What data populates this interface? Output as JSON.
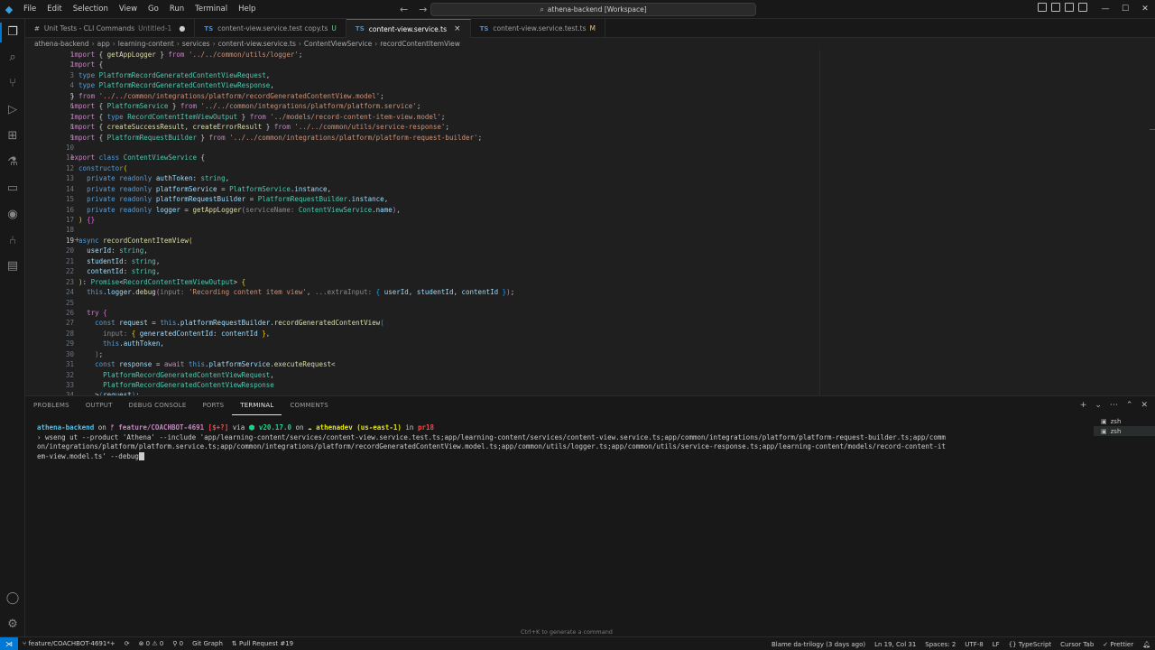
{
  "menu": [
    "File",
    "Edit",
    "Selection",
    "View",
    "Go",
    "Run",
    "Terminal",
    "Help"
  ],
  "search": {
    "label": "athena-backend [Workspace]"
  },
  "tabs": [
    {
      "icon": "#",
      "label": "Unit Tests - CLI Commands",
      "sub": "Untitled-1",
      "state": "dot"
    },
    {
      "icon": "TS",
      "label": "content-view.service.test copy.ts",
      "sub": "U",
      "state": ""
    },
    {
      "icon": "TS",
      "label": "content-view.service.ts",
      "sub": "",
      "state": "close"
    },
    {
      "icon": "TS",
      "label": "content-view.service.test.ts",
      "sub": "M",
      "state": ""
    }
  ],
  "breadcrumb": [
    "athena-backend",
    "app",
    "learning-content",
    "services",
    "content-view.service.ts",
    "ContentViewService",
    "recordContentItemView"
  ],
  "editor": {
    "current_line": 19,
    "lines": [
      [
        [
          "kw2",
          "import"
        ],
        [
          "plain",
          " { "
        ],
        [
          "fn",
          "getAppLogger"
        ],
        [
          "plain",
          " } "
        ],
        [
          "kw2",
          "from"
        ],
        [
          "str",
          " '../../common/utils/logger'"
        ],
        [
          "plain",
          ";"
        ]
      ],
      [
        [
          "kw2",
          "import"
        ],
        [
          "plain",
          " {"
        ]
      ],
      [
        [
          "plain",
          "  "
        ],
        [
          "kw",
          "type"
        ],
        [
          "ty",
          " PlatformRecordGeneratedContentViewRequest"
        ],
        [
          "plain",
          ","
        ]
      ],
      [
        [
          "plain",
          "  "
        ],
        [
          "kw",
          "type"
        ],
        [
          "ty",
          " PlatformRecordGeneratedContentViewResponse"
        ],
        [
          "plain",
          ","
        ]
      ],
      [
        [
          "plain",
          "} "
        ],
        [
          "kw2",
          "from"
        ],
        [
          "str",
          " '../../common/integrations/platform/recordGeneratedContentView.model'"
        ],
        [
          "plain",
          ";"
        ]
      ],
      [
        [
          "kw2",
          "import"
        ],
        [
          "plain",
          " { "
        ],
        [
          "ty",
          "PlatformService"
        ],
        [
          "plain",
          " } "
        ],
        [
          "kw2",
          "from"
        ],
        [
          "str",
          " '../../common/integrations/platform/platform.service'"
        ],
        [
          "plain",
          ";"
        ]
      ],
      [
        [
          "kw2",
          "import"
        ],
        [
          "plain",
          " { "
        ],
        [
          "kw",
          "type"
        ],
        [
          "ty",
          " RecordContentItemViewOutput"
        ],
        [
          "plain",
          " } "
        ],
        [
          "kw2",
          "from"
        ],
        [
          "str",
          " '../models/record-content-item-view.model'"
        ],
        [
          "plain",
          ";"
        ]
      ],
      [
        [
          "kw2",
          "import"
        ],
        [
          "plain",
          " { "
        ],
        [
          "fn",
          "createSuccessResult"
        ],
        [
          "plain",
          ", "
        ],
        [
          "fn",
          "createErrorResult"
        ],
        [
          "plain",
          " } "
        ],
        [
          "kw2",
          "from"
        ],
        [
          "str",
          " '../../common/utils/service-response'"
        ],
        [
          "plain",
          ";"
        ]
      ],
      [
        [
          "kw2",
          "import"
        ],
        [
          "plain",
          " { "
        ],
        [
          "ty",
          "PlatformRequestBuilder"
        ],
        [
          "plain",
          " } "
        ],
        [
          "kw2",
          "from"
        ],
        [
          "str",
          " '../../common/integrations/platform/platform-request-builder'"
        ],
        [
          "plain",
          ";"
        ]
      ],
      [],
      [
        [
          "kw2",
          "export"
        ],
        [
          "kw",
          " class"
        ],
        [
          "ty",
          " ContentViewService"
        ],
        [
          "plain",
          " {"
        ]
      ],
      [
        [
          "plain",
          "  "
        ],
        [
          "kw",
          "constructor"
        ],
        [
          "br",
          "("
        ]
      ],
      [
        [
          "plain",
          "    "
        ],
        [
          "kw",
          "private"
        ],
        [
          "kw",
          " readonly"
        ],
        [
          "var",
          " authToken"
        ],
        [
          "plain",
          ": "
        ],
        [
          "ty",
          "string"
        ],
        [
          "plain",
          ","
        ]
      ],
      [
        [
          "plain",
          "    "
        ],
        [
          "kw",
          "private"
        ],
        [
          "kw",
          " readonly"
        ],
        [
          "var",
          " platformService"
        ],
        [
          "plain",
          " = "
        ],
        [
          "ty",
          "PlatformService"
        ],
        [
          "plain",
          "."
        ],
        [
          "var",
          "instance"
        ],
        [
          "plain",
          ","
        ]
      ],
      [
        [
          "plain",
          "    "
        ],
        [
          "kw",
          "private"
        ],
        [
          "kw",
          " readonly"
        ],
        [
          "var",
          " platformRequestBuilder"
        ],
        [
          "plain",
          " = "
        ],
        [
          "ty",
          "PlatformRequestBuilder"
        ],
        [
          "plain",
          "."
        ],
        [
          "var",
          "instance"
        ],
        [
          "plain",
          ","
        ]
      ],
      [
        [
          "plain",
          "    "
        ],
        [
          "kw",
          "private"
        ],
        [
          "kw",
          " readonly"
        ],
        [
          "var",
          " logger"
        ],
        [
          "plain",
          " = "
        ],
        [
          "fn",
          "getAppLogger"
        ],
        [
          "pn",
          "("
        ],
        [
          "hint",
          "serviceName: "
        ],
        [
          "ty",
          "ContentViewService"
        ],
        [
          "plain",
          "."
        ],
        [
          "var",
          "name"
        ],
        [
          "pn",
          ")"
        ],
        [
          "plain",
          ","
        ]
      ],
      [
        [
          "plain",
          "  "
        ],
        [
          "br",
          ")"
        ],
        [
          "plain",
          " "
        ],
        [
          "pn",
          "{}"
        ]
      ],
      [],
      [
        [
          "plain",
          "  "
        ],
        [
          "kw",
          "async"
        ],
        [
          "fn",
          " recordContentItemView"
        ],
        [
          "br",
          "("
        ]
      ],
      [
        [
          "plain",
          "    "
        ],
        [
          "var",
          "userId"
        ],
        [
          "plain",
          ": "
        ],
        [
          "ty",
          "string"
        ],
        [
          "plain",
          ","
        ]
      ],
      [
        [
          "plain",
          "    "
        ],
        [
          "var",
          "studentId"
        ],
        [
          "plain",
          ": "
        ],
        [
          "ty",
          "string"
        ],
        [
          "plain",
          ","
        ]
      ],
      [
        [
          "plain",
          "    "
        ],
        [
          "var",
          "contentId"
        ],
        [
          "plain",
          ": "
        ],
        [
          "ty",
          "string"
        ],
        [
          "plain",
          ","
        ]
      ],
      [
        [
          "plain",
          "  "
        ],
        [
          "br",
          ")"
        ],
        [
          "plain",
          ": "
        ],
        [
          "ty",
          "Promise"
        ],
        [
          "plain",
          "<"
        ],
        [
          "ty",
          "RecordContentItemViewOutput"
        ],
        [
          "plain",
          "> "
        ],
        [
          "br",
          "{"
        ]
      ],
      [
        [
          "plain",
          "    "
        ],
        [
          "kw",
          "this"
        ],
        [
          "plain",
          "."
        ],
        [
          "var",
          "logger"
        ],
        [
          "plain",
          "."
        ],
        [
          "fn",
          "debug"
        ],
        [
          "pn",
          "("
        ],
        [
          "hint",
          "input: "
        ],
        [
          "str",
          "'Recording content item view'"
        ],
        [
          "plain",
          ", "
        ],
        [
          "hint",
          "...extraInput: "
        ],
        [
          "br2",
          "{"
        ],
        [
          "var",
          " userId"
        ],
        [
          "plain",
          ", "
        ],
        [
          "var",
          "studentId"
        ],
        [
          "plain",
          ", "
        ],
        [
          "var",
          "contentId"
        ],
        [
          "br2",
          " }"
        ],
        [
          "pn",
          ")"
        ],
        [
          "plain",
          ";"
        ]
      ],
      [],
      [
        [
          "plain",
          "    "
        ],
        [
          "kw2",
          "try"
        ],
        [
          "plain",
          " "
        ],
        [
          "pn",
          "{"
        ]
      ],
      [
        [
          "plain",
          "      "
        ],
        [
          "kw",
          "const"
        ],
        [
          "var",
          " request"
        ],
        [
          "plain",
          " = "
        ],
        [
          "kw",
          "this"
        ],
        [
          "plain",
          "."
        ],
        [
          "var",
          "platformRequestBuilder"
        ],
        [
          "plain",
          "."
        ],
        [
          "fn",
          "recordGeneratedContentView"
        ],
        [
          "br2",
          "("
        ]
      ],
      [
        [
          "plain",
          "        "
        ],
        [
          "hint",
          "input: "
        ],
        [
          "br",
          "{"
        ],
        [
          "var",
          " generatedContentId"
        ],
        [
          "plain",
          ": "
        ],
        [
          "var",
          "contentId"
        ],
        [
          "br",
          " }"
        ],
        [
          "plain",
          ","
        ]
      ],
      [
        [
          "plain",
          "        "
        ],
        [
          "kw",
          "this"
        ],
        [
          "plain",
          "."
        ],
        [
          "var",
          "authToken"
        ],
        [
          "plain",
          ","
        ]
      ],
      [
        [
          "plain",
          "      "
        ],
        [
          "br2",
          ")"
        ],
        [
          "plain",
          ";"
        ]
      ],
      [
        [
          "plain",
          "      "
        ],
        [
          "kw",
          "const"
        ],
        [
          "var",
          " response"
        ],
        [
          "plain",
          " = "
        ],
        [
          "kw2",
          "await"
        ],
        [
          "kw",
          " this"
        ],
        [
          "plain",
          "."
        ],
        [
          "var",
          "platformService"
        ],
        [
          "plain",
          "."
        ],
        [
          "fn",
          "executeRequest"
        ],
        [
          "plain",
          "<"
        ]
      ],
      [
        [
          "plain",
          "        "
        ],
        [
          "ty",
          "PlatformRecordGeneratedContentViewRequest"
        ],
        [
          "plain",
          ","
        ]
      ],
      [
        [
          "plain",
          "        "
        ],
        [
          "ty",
          "PlatformRecordGeneratedContentViewResponse"
        ]
      ],
      [
        [
          "plain",
          "      >"
        ],
        [
          "br2",
          "("
        ],
        [
          "var",
          "request"
        ],
        [
          "br2",
          ")"
        ],
        [
          "plain",
          ";"
        ]
      ]
    ]
  },
  "panel": {
    "tabs": [
      "PROBLEMS",
      "OUTPUT",
      "DEBUG CONSOLE",
      "PORTS",
      "TERMINAL",
      "COMMENTS"
    ],
    "active_tab": "TERMINAL",
    "terminals": [
      "zsh",
      "zsh"
    ],
    "prompt": {
      "dir": "athena-backend",
      "on1": " on ",
      "branch": "ᚠ feature/COACHBOT-4691",
      "status": " [$+?]",
      "via": " via ",
      "node": "⬢ v20.17.0",
      "on2": " on ",
      "aws": "☁ athenadev (us-east-1)",
      "in": " in ",
      "time": "pr18"
    },
    "command_lines": [
      "› wseng ut --product 'Athena' --include 'app/learning-content/services/content-view.service.test.ts;app/learning-content/services/content-view.service.ts;app/common/integrations/platform/platform-request-builder.ts;app/comm",
      "on/integrations/platform/platform.service.ts;app/common/integrations/platform/recordGeneratedContentView.model.ts;app/common/utils/logger.ts;app/common/utils/service-response.ts;app/learning-content/models/record-content-it",
      "em-view.model.ts' --debug"
    ],
    "hint": "Ctrl+K to generate a command"
  },
  "statusbar": {
    "branch": "feature/COACHBOT-4691*+",
    "sync": "⟳",
    "errors": "⊗ 0 ⚠ 0",
    "ports": "⚲ 0",
    "git_graph": "Git Graph",
    "pr": "Pull Request #19",
    "blame": "Blame da-trilogy (3 days ago)",
    "position": "Ln 19, Col 31",
    "spaces": "Spaces: 2",
    "encoding": "UTF-8",
    "eol": "LF",
    "language": "TypeScript",
    "cursor_tab": "Cursor Tab",
    "prettier": "✓ Prettier"
  },
  "colors": {
    "accent": "#0078d4",
    "bg": "#1f1f1f",
    "chrome": "#181818"
  }
}
